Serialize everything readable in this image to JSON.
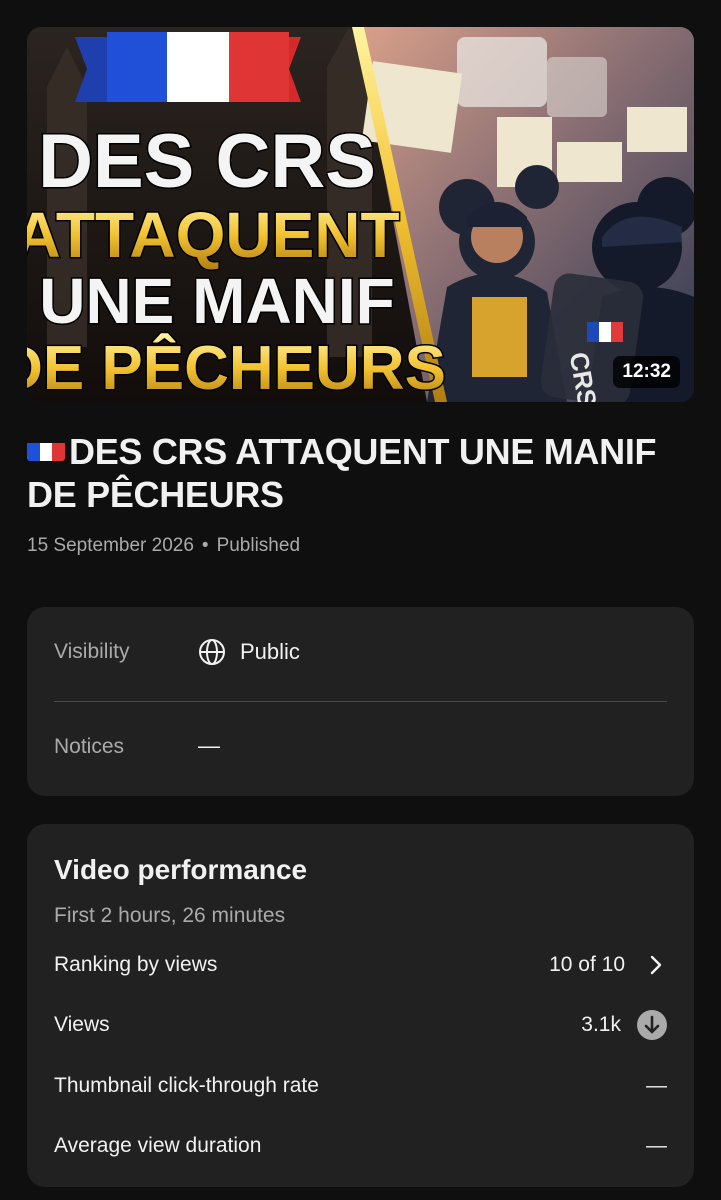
{
  "video": {
    "thumbnail_text": [
      "DES CRS",
      "ATTAQUENT",
      "UNE MANIF",
      "DE PÊCHEURS"
    ],
    "duration": "12:32",
    "title": "DES CRS ATTAQUENT UNE MANIF DE PÊCHEURS",
    "date": "15 September 2026",
    "separator": "•",
    "status": "Published"
  },
  "details": {
    "visibility_label": "Visibility",
    "visibility_value": "Public",
    "notices_label": "Notices",
    "notices_value": "—"
  },
  "performance": {
    "title": "Video performance",
    "subtitle": "First 2 hours, 26 minutes",
    "rows": [
      {
        "label": "Ranking by views",
        "value": "10 of 10",
        "icon": "chevron-right-icon"
      },
      {
        "label": "Views",
        "value": "3.1k",
        "icon": "arrow-down-circle-icon"
      },
      {
        "label": "Thumbnail click-through rate",
        "value": "—"
      },
      {
        "label": "Average view duration",
        "value": "—"
      }
    ]
  },
  "colors": {
    "background": "#0f0f0f",
    "card": "#212121",
    "text": "#f1f1f1",
    "muted": "#aaaaaa",
    "thumbnail_gold": "#f2c230"
  }
}
